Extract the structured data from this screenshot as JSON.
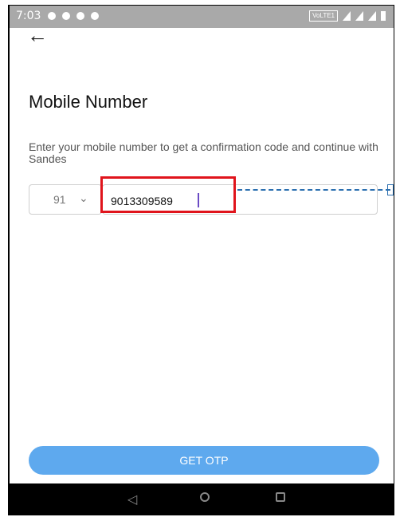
{
  "status": {
    "time": "7:03",
    "network_badge": "VoLTE1"
  },
  "header": {
    "back_icon": "arrow-left-icon",
    "title": "Mobile Number"
  },
  "form": {
    "description": "Enter your mobile number to get a confirmation code and continue with Sandes",
    "country_code": "91",
    "phone_number": "9013309589"
  },
  "actions": {
    "get_otp_label": "GET OTP"
  },
  "colors": {
    "accent": "#5ea9ee",
    "highlight": "#e0141c",
    "annotation": "#2b6fb0"
  }
}
